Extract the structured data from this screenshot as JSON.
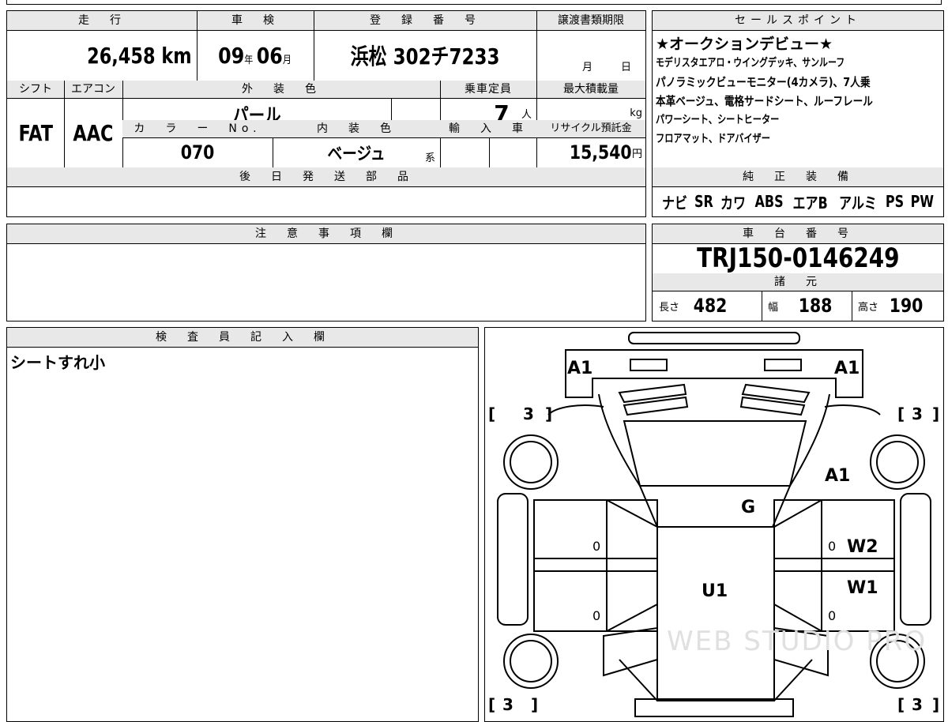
{
  "top_table": {
    "headers": {
      "mileage": "走　行",
      "inspection": "車　検",
      "registration": "登　録　番　号",
      "transfer_deadline": "譲渡書類期限",
      "shift": "シフト",
      "aircon": "エアコン",
      "exterior_color": "外　装　色",
      "capacity": "乗車定員",
      "max_load": "最大積載量",
      "color_no": "カ　ラ　ー　No.",
      "interior_color": "内　装　色",
      "import": "輸　入　車",
      "recycle": "リサイクル預託金",
      "later_parts": "後　日　発　送　部　品"
    },
    "mileage_value": "26,458",
    "mileage_unit": "km",
    "inspection_year": "09",
    "year_unit": "年",
    "inspection_month": "06",
    "month_unit": "月",
    "registration_value": "浜松 302チ7233",
    "deadline_month_unit": "月",
    "deadline_day_unit": "日",
    "shift_value": "FAT",
    "aircon_value": "AAC",
    "exterior_value": "パール",
    "capacity_value": "7",
    "capacity_unit": "人",
    "max_load_unit": "kg",
    "color_no_value": "070",
    "interior_value": "ベージュ",
    "interior_suffix": "系",
    "recycle_value": "15,540",
    "recycle_unit": "円"
  },
  "sales_points": {
    "header": "セールスポイント",
    "lines": [
      "★オークションデビュー★",
      "モデリスタエアロ・ウイングデッキ、サンルーフ",
      "パノラミックビューモニター(4カメラ)、7人乗",
      "本革ベージュ、電格サードシート、ルーフレール",
      "パワーシート、シートヒーター",
      "フロアマット、ドアバイザー"
    ]
  },
  "genuine_equipment": {
    "header": "純　正　装　備",
    "items": [
      "ナビ",
      "SR",
      "カワ",
      "ABS",
      "エアB",
      "アルミ",
      "PS",
      "PW"
    ]
  },
  "notes": {
    "header": "注　意　事　項　欄"
  },
  "chassis": {
    "header": "車　台　番　号",
    "value": "TRJ150-0146249"
  },
  "specs": {
    "header": "諸　元",
    "length_label": "長さ",
    "length_value": "482",
    "width_label": "幅",
    "width_value": "188",
    "height_label": "高さ",
    "height_value": "190"
  },
  "inspector": {
    "header": "検　査　員　記　入　欄",
    "comment": "シートすれ小"
  },
  "diagram": {
    "marks": {
      "front_left": "A1",
      "front_right": "A1",
      "right_fender": "A1",
      "glass": "G",
      "right_front_door": "W2",
      "right_rear_door": "W1",
      "roof": "U1"
    },
    "tire_scores": [
      "3",
      "3",
      "3",
      "3"
    ],
    "door_zeros": [
      "0",
      "0",
      "0",
      "0"
    ],
    "watermark": "WEB STUDIO PRO"
  }
}
